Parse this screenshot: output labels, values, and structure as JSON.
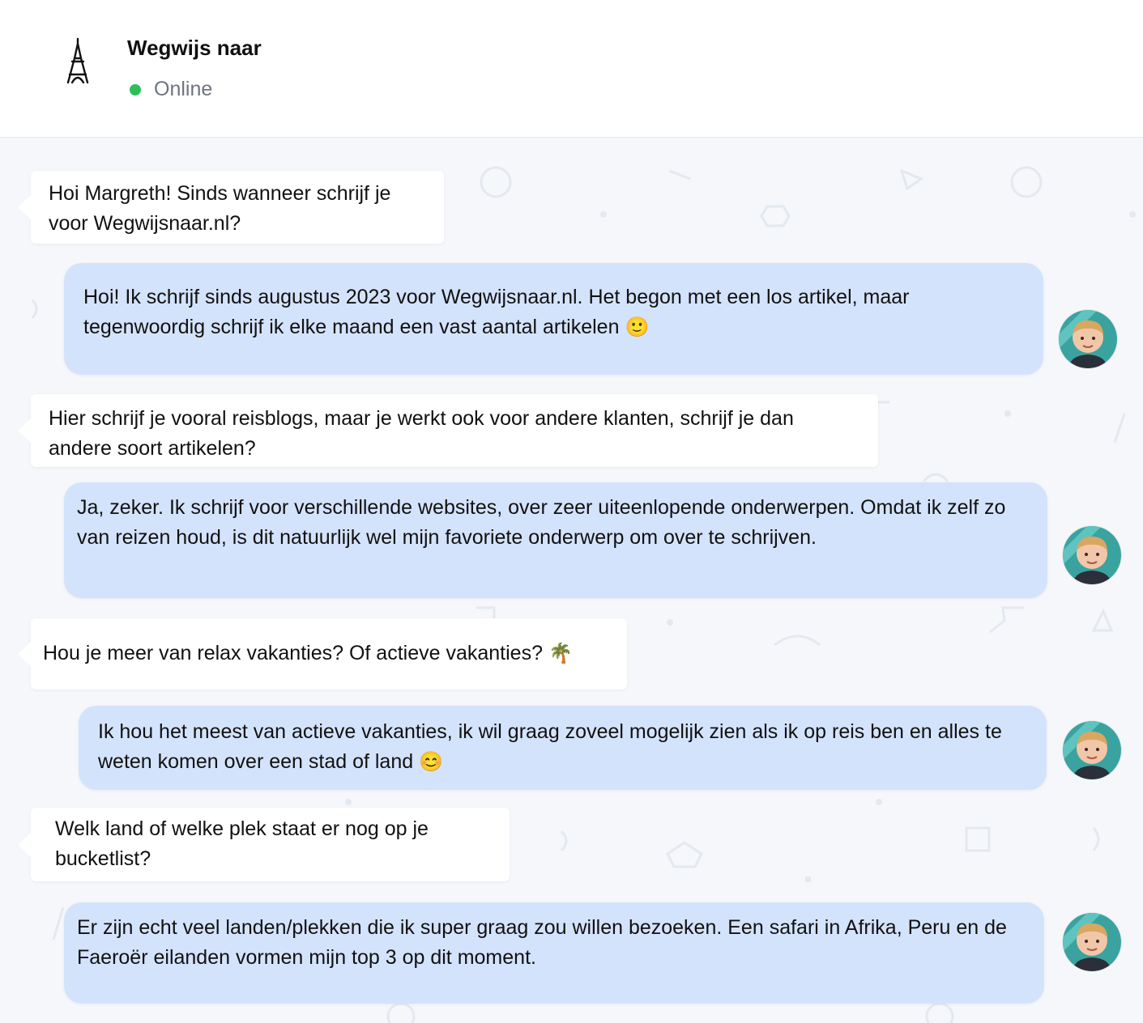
{
  "header": {
    "title": "Wegwijs naar",
    "status": "Online",
    "logo_icon": "eiffel-tower-icon",
    "status_color": "#2dbe5a"
  },
  "colors": {
    "incoming_bubble": "#ffffff",
    "outgoing_bubble": "#d4e3fc",
    "background": "#f5f7fb"
  },
  "messages": [
    {
      "side": "in",
      "text": "Hoi Margreth! Sinds wanneer schrijf je voor Wegwijsnaar.nl?"
    },
    {
      "side": "out",
      "text": "Hoi! Ik schrijf sinds augustus 2023 voor Wegwijsnaar.nl. Het begon met een los artikel, maar tegenwoordig schrijf ik elke maand een vast aantal artikelen",
      "emoji": "🙂"
    },
    {
      "side": "in",
      "text": "Hier schrijf je vooral reisblogs, maar je werkt ook voor andere klanten, schrijf je dan andere soort artikelen?"
    },
    {
      "side": "out",
      "text": "Ja, zeker. Ik schrijf voor verschillende websites, over zeer uiteenlopende onderwerpen. Omdat ik zelf zo van reizen houd, is dit natuurlijk wel mijn favoriete onderwerp om over te schrijven."
    },
    {
      "side": "in",
      "text": "Hou je meer van relax vakanties? Of actieve vakanties?",
      "emoji": "🌴"
    },
    {
      "side": "out",
      "text": "Ik hou het meest van actieve vakanties, ik wil graag zoveel mogelijk zien als ik op reis ben en alles te weten komen over een stad of land",
      "emoji": "😊"
    },
    {
      "side": "in",
      "text": "Welk land of welke plek staat er nog op je bucketlist?"
    },
    {
      "side": "out",
      "text": "Er zijn echt veel landen/plekken die ik super graag zou willen bezoeken. Een safari in Afrika, Peru en de Faeroër eilanden vormen mijn top 3 op dit moment."
    }
  ]
}
